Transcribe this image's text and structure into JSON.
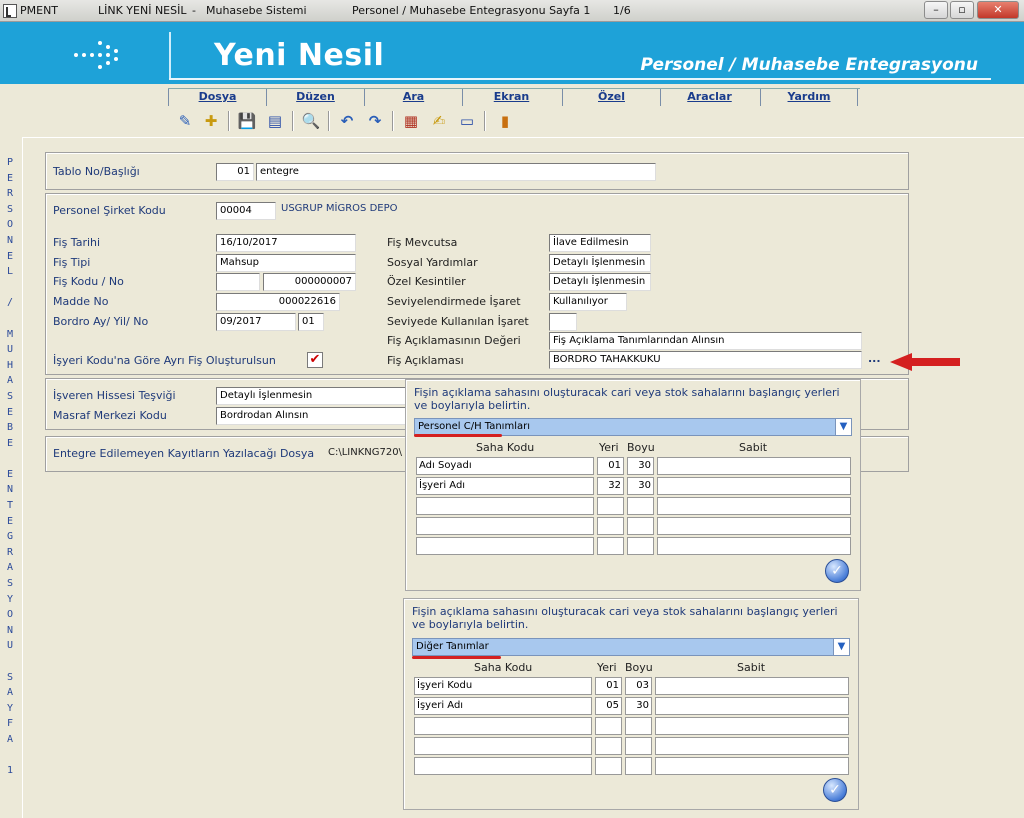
{
  "window": {
    "app_code": "PMENT",
    "app_name": "LİNK YENİ NESİL",
    "system": "Muhasebe Sistemi",
    "page_title": "Personel / Muhasebe Entegrasyonu Sayfa 1",
    "page_counter": "1/6",
    "minimize": "–",
    "restore": "▫",
    "close": "✕"
  },
  "banner": {
    "brand": "Yeni Nesil",
    "module": "Personel / Muhasebe Entegrasyonu",
    "logo_icon": "dots-logo-icon",
    "color": "#1ea2d8"
  },
  "menu": [
    "Dosya",
    "Düzen",
    "Ara",
    "Ekran",
    "Özel",
    "Araclar",
    "Yardım"
  ],
  "toolbar": {
    "icons": [
      "approve-icon",
      "new-record-icon",
      "save-icon",
      "print-icon",
      "search-icon",
      "undo-icon",
      "redo-icon",
      "calendar-icon",
      "edit-icon",
      "card-icon",
      "report-icon"
    ],
    "glyphs": [
      "✎",
      "✚",
      "💾",
      "▤",
      "🔍",
      "↶",
      "↷",
      "▦",
      "✍",
      "▭",
      "▮"
    ]
  },
  "sidetext": "P\nE\nR\nS\nO\nN\nE\nL\n \n/\n \nM\nU\nH\nA\nS\nE\nB\nE\n \nE\nN\nT\nE\nG\nR\nA\nS\nY\nO\nN\nU\n \nS\nA\nY\nF\nA\n \n1",
  "form": {
    "tablo_label": "Tablo No/Başlığı",
    "tablo_no": "01",
    "tablo_name": "entegre",
    "sirket_label": "Personel Şirket Kodu",
    "sirket_kodu": "00004",
    "sirket_name": "USGRUP MİGROS DEPO",
    "fis_tarihi_label": "Fiş Tarihi",
    "fis_tarihi": "16/10/2017",
    "fis_tipi_label": "Fiş Tipi",
    "fis_tipi": "Mahsup",
    "fis_kodu_label": "Fiş Kodu / No",
    "fis_kodu": "",
    "fis_no": "000000007",
    "madde_label": "Madde No",
    "madde_no": "000022616",
    "bordro_label": "Bordro Ay/ Yil/ No",
    "bordro_ay_yil": "09/2017",
    "bordro_no": "01",
    "isyeri_label": "İşyeri Kodu'na Göre Ayrı Fiş Oluşturulsun",
    "isyeri_checked": "✔",
    "mevcutsa_label": "Fiş Mevcutsa",
    "mevcutsa": "İlave Edilmesin",
    "sosyal_label": "Sosyal Yardımlar",
    "sosyal": "Detaylı İşlenmesin",
    "ozel_label": "Özel Kesintiler",
    "ozel": "Detaylı İşlenmesin",
    "seviye_isaret_label": "Seviyelendirmede İşaret",
    "seviye_isaret": "Kullanılıyor",
    "seviye_kullanilan_label": "Seviyede Kullanılan İşaret",
    "seviye_kullanilan": "",
    "aciklama_deger_label": "Fiş Açıklamasının Değeri",
    "aciklama_deger": "Fiş Açıklama Tanımlarından Alınsın",
    "aciklama_label": "Fiş Açıklaması",
    "aciklama": "BORDRO TAHAKKUKU",
    "ellipsis": "...",
    "isveren_label": "İşveren Hissesi Teşviği",
    "isveren": "Detaylı İşlenmesin",
    "masraf_label": "Masraf Merkezi Kodu",
    "masraf": "Bordrodan Alınsın",
    "entegre_label": "Entegre Edilemeyen Kayıtların Yazılacağı Dosya",
    "entegre_dosya": "C:\\LINKNG720\\"
  },
  "popup1": {
    "desc": "Fişin açıklama sahasını oluşturacak cari veya stok sahalarını başlangıç yerleri ve boylarıyla belirtin.",
    "combo": "Personel C/H Tanımları",
    "headers": [
      "Saha Kodu",
      "Yeri",
      "Boyu",
      "Sabit"
    ],
    "rows": [
      [
        "Adı Soyadı",
        "01",
        "30",
        ""
      ],
      [
        "İşyeri Adı",
        "32",
        "30",
        ""
      ],
      [
        "",
        "",
        "",
        ""
      ],
      [
        "",
        "",
        "",
        ""
      ],
      [
        "",
        "",
        "",
        ""
      ]
    ],
    "ok": "✓"
  },
  "popup2": {
    "desc": "Fişin açıklama sahasını oluşturacak cari veya stok sahalarını başlangıç yerleri ve boylarıyla belirtin.",
    "combo": "Diğer Tanımlar",
    "headers": [
      "Saha Kodu",
      "Yeri",
      "Boyu",
      "Sabit"
    ],
    "rows": [
      [
        "İşyeri Kodu",
        "01",
        "03",
        ""
      ],
      [
        "İşyeri Adı",
        "05",
        "30",
        ""
      ],
      [
        "",
        "",
        "",
        ""
      ],
      [
        "",
        "",
        "",
        ""
      ],
      [
        "",
        "",
        "",
        ""
      ]
    ],
    "ok": "✓"
  },
  "colors": {
    "label": "#1f3a7a",
    "accent_red": "#d42020",
    "combo": "#a8c8ee"
  }
}
